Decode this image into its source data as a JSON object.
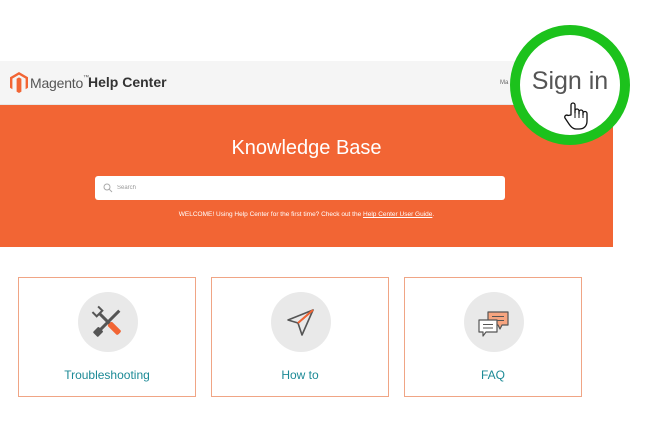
{
  "header": {
    "brand": "Magento",
    "brand_mark": "™",
    "title": "Help Center",
    "link_partial": "Ma"
  },
  "hero": {
    "title": "Knowledge Base",
    "search_placeholder": "Search",
    "welcome_text": "WELCOME! Using Help Center for the first time? Check out the ",
    "welcome_link": "Help Center User Guide",
    "welcome_end": "."
  },
  "cards": [
    {
      "label": "Troubleshooting",
      "icon": "tools-icon"
    },
    {
      "label": "How to",
      "icon": "paper-plane-icon"
    },
    {
      "label": "FAQ",
      "icon": "chat-bubbles-icon"
    }
  ],
  "callout": {
    "label": "Sign in",
    "icon": "hand-pointer-icon"
  },
  "colors": {
    "brand_orange": "#f26534",
    "teal": "#1c8a96",
    "callout_green": "#1cc21c"
  }
}
